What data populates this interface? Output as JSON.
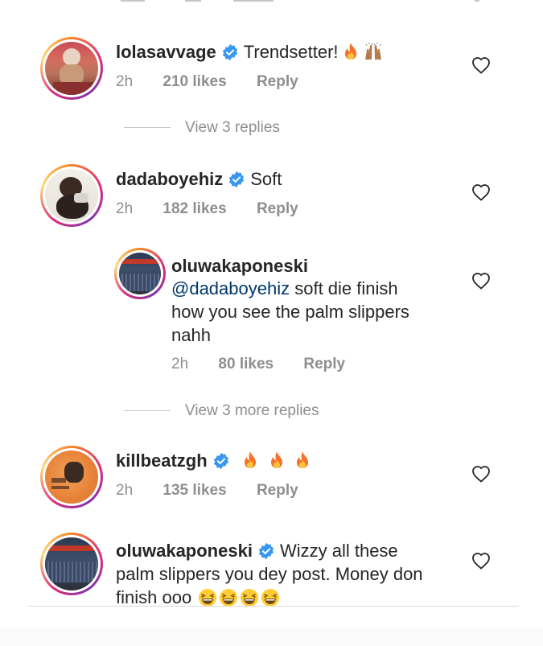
{
  "comments": [
    {
      "username": "lolasavvage",
      "text": "Trendsetter!",
      "emojis": [
        "fire-icon",
        "raised-hands-icon"
      ],
      "time": "2h",
      "likes": "210 likes",
      "reply": "Reply"
    },
    {
      "username": "dadaboyehiz",
      "text": "Soft",
      "time": "2h",
      "likes": "182 likes",
      "reply": "Reply"
    },
    {
      "username": "killbeatzgh",
      "text": "",
      "emojis": [
        "fire-icon",
        "fire-icon",
        "fire-icon"
      ],
      "time": "2h",
      "likes": "135 likes",
      "reply": "Reply"
    },
    {
      "username": "oluwakaponeski",
      "text_line1": "Wizzy all these",
      "text_line2": "palm slippers you dey post. Money don",
      "text_line3": "finish ooo",
      "emojis": [
        "laughing-face-icon",
        "laughing-face-icon",
        "laughing-face-icon",
        "laughing-face-icon"
      ]
    }
  ],
  "reply_thread": {
    "username": "oluwakaponeski",
    "mention": "@dadaboyehiz",
    "text_line1": " soft die finish",
    "text_line2": "how you see the palm slippers",
    "text_line3": "nahh",
    "time": "2h",
    "likes": "80 likes",
    "reply": "Reply"
  },
  "view_replies_1": "View 3 replies",
  "view_replies_2": "View 3 more replies",
  "colors": {
    "mention": "#00376b",
    "verified": "#3897f0",
    "secondary_text": "#8e8e8e"
  }
}
